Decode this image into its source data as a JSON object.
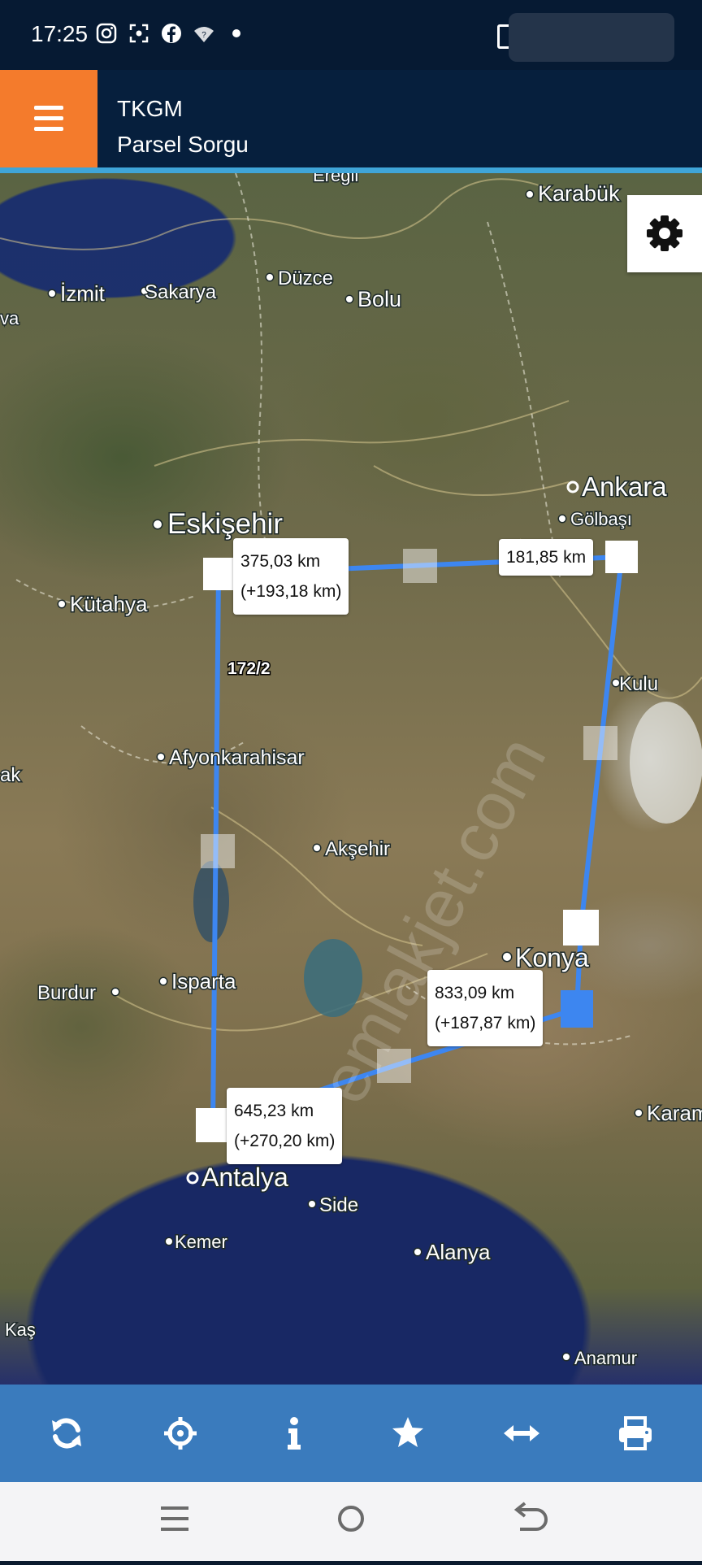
{
  "status_bar": {
    "time": "17:25",
    "icons": [
      "instagram-icon",
      "screenshot-icon",
      "facebook-icon",
      "wifi-question-icon",
      "dot-icon"
    ]
  },
  "header": {
    "title": "TKGM",
    "subtitle": "Parsel Sorgu",
    "menu_icon": "hamburger-menu-icon"
  },
  "map": {
    "places": [
      "Ereğli",
      "Karabük",
      "İzmit",
      "Sakarya",
      "Düzce",
      "Bolu",
      "Ankara",
      "Gölbaşı",
      "Eskişehir",
      "Kütahya",
      "Kulu",
      "Afyonkarahisar",
      "Akşehir",
      "Konya",
      "Burdur",
      "Isparta",
      "Karam",
      "Antalya",
      "Side",
      "Kemer",
      "Alanya",
      "Kaş",
      "Anamur",
      "ak",
      "va"
    ],
    "parcel_label": "172/2",
    "watermark": "emlakjet.com",
    "measure_labels": [
      {
        "line1": "375,03 km",
        "line2": "(+193,18 km)"
      },
      {
        "line1": "181,85 km",
        "line2": ""
      },
      {
        "line1": "833,09 km",
        "line2": "(+187,87 km)"
      },
      {
        "line1": "645,23 km",
        "line2": "(+270,20 km)"
      }
    ],
    "line_color": "#3d86f0"
  },
  "settings": {
    "icon": "gear-icon"
  },
  "toolbar": {
    "buttons": [
      "refresh-icon",
      "locate-crosshair-icon",
      "info-icon",
      "star-icon",
      "measure-arrows-icon",
      "print-icon"
    ]
  },
  "nav_bar": {
    "buttons": [
      "recent-apps-icon",
      "home-icon",
      "back-icon"
    ]
  }
}
